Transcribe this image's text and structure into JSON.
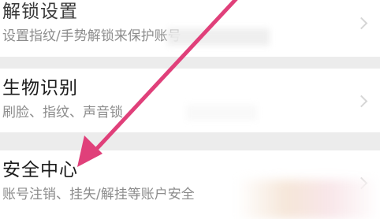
{
  "settings": {
    "items": [
      {
        "title": "解锁设置",
        "subtitle": "设置指纹/手势解锁来保护账号"
      },
      {
        "title": "生物识别",
        "subtitle": "刷脸、指纹、声音锁"
      },
      {
        "title": "安全中心",
        "subtitle": "账号注销、挂失/解挂等账户安全"
      }
    ]
  },
  "annotation": {
    "arrow_color": "#e0407a",
    "icon": "pointer-arrow"
  },
  "colors": {
    "page_background": "#ececec",
    "row_background": "#ffffff",
    "title_text": "#1c1c1c",
    "subtitle_text": "#8c8c8c"
  }
}
